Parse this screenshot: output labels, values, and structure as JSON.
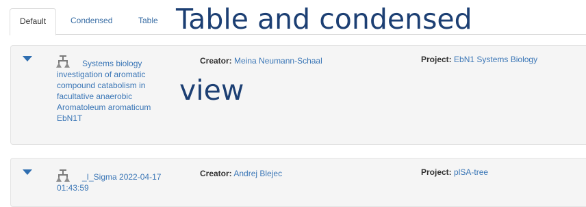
{
  "tabs": [
    "Default",
    "Condensed",
    "Table"
  ],
  "overlay": {
    "line1": "Table and condensed",
    "line2": "view"
  },
  "items": [
    {
      "title": "Systems biology investigation of aromatic compound catabolism in facultative anaerobic Aromatoleum aromaticum EbN1T",
      "creator_label": "Creator:",
      "creator": "Meina Neumann-Schaal",
      "project_label": "Project:",
      "project": "EbN1 Systems Biology"
    },
    {
      "title": "_I_Sigma 2022-04-17 01:43:59",
      "creator_label": "Creator:",
      "creator": "Andrej Blejec",
      "project_label": "Project:",
      "project": "plSA-tree"
    }
  ]
}
